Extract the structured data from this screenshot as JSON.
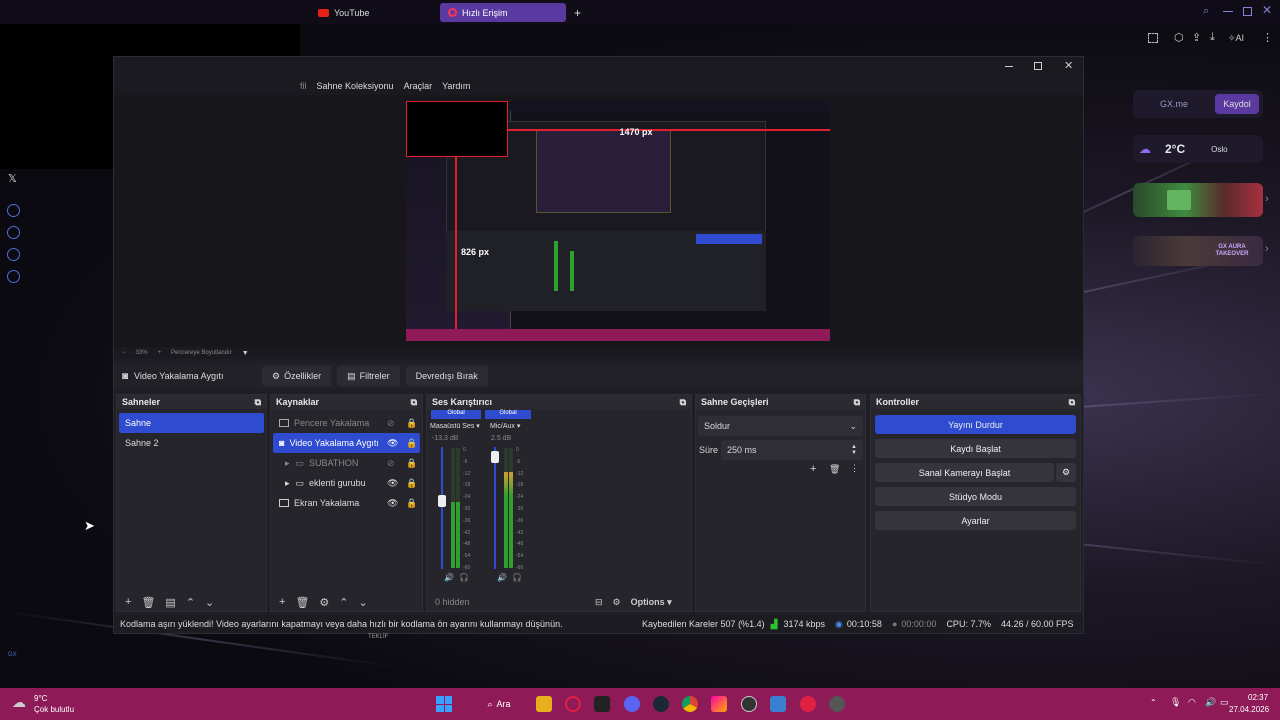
{
  "browser": {
    "tabs": [
      {
        "label": "YouTube"
      },
      {
        "label": "Hızlı Erişim"
      }
    ],
    "toolbar_ai": "AI"
  },
  "widgets": {
    "gx_me": "GX.me",
    "kaydol": "Kaydol",
    "temp": "2°C",
    "city": "Oslo",
    "aura": "GX AURA TAKEOVER"
  },
  "obs": {
    "menu": [
      "fil",
      "Sahne Koleksiyonu",
      "Araçlar",
      "Yardım"
    ],
    "preview": {
      "width_label": "1470 px",
      "height_label": "826 px"
    },
    "zoom": {
      "minus": "−",
      "value": "33%",
      "plus": "+",
      "fit": "Pencereye Boyutlandır"
    },
    "source_toolbar": {
      "name": "Video Yakalama Aygıtı",
      "properties": "Özellikler",
      "filters": "Filtreler",
      "deactivate": "Devredışı Bırak"
    },
    "scenes": {
      "title": "Sahneler",
      "items": [
        "Sahne",
        "Sahne 2"
      ]
    },
    "sources": {
      "title": "Kaynaklar",
      "items": [
        {
          "label": "Pencere Yakalama",
          "type": "window"
        },
        {
          "label": "Video Yakalama Aygıtı",
          "type": "camera"
        },
        {
          "label": "SUBATHON",
          "type": "group"
        },
        {
          "label": "eklenti gurubu",
          "type": "group"
        },
        {
          "label": "Ekran Yakalama",
          "type": "display"
        }
      ]
    },
    "mixer": {
      "title": "Ses Karıştırıcı",
      "channels": [
        {
          "badge": "Global",
          "name": "Masaüstü Ses",
          "db": "-13.3 dB",
          "level": 0.55
        },
        {
          "badge": "Global",
          "name": "Mic/Aux",
          "db": "2.5 dB",
          "level": 0.8
        }
      ],
      "scale": [
        "0",
        "-6",
        "-12",
        "-18",
        "-24",
        "-30",
        "-36",
        "-42",
        "-48",
        "-54",
        "-60"
      ],
      "hidden": "0 hidden",
      "options": "Options"
    },
    "transitions": {
      "title": "Sahne Geçişleri",
      "selected": "Soldur",
      "duration_label": "Süre",
      "duration": "250 ms"
    },
    "controls": {
      "title": "Kontroller",
      "buttons": [
        "Yayını Durdur",
        "Kaydı Başlat",
        "Sanal Kamerayı Başlat",
        "Stüdyo Modu",
        "Ayarlar"
      ]
    },
    "status": {
      "message": "Kodlama aşırı yüklendi! Video ayarlarını kapatmayı veya daha hızlı bir kodlama ön ayarını kullanmayı düşünün.",
      "dropped": "Kaybedilen Kareler 507 (%1.4)",
      "bitrate": "3174 kbps",
      "live_time": "00:10:58",
      "rec_time": "00:00:00",
      "cpu": "CPU: 7.7%",
      "fps": "44.26 / 60.00 FPS"
    }
  },
  "taskbar": {
    "weather_temp": "9°C",
    "weather_desc": "Çok bulutlu",
    "search": "Ara",
    "time": "02:37",
    "date": "27.04.2026"
  },
  "desktop": {
    "teklif": "TEKLİF"
  },
  "colors": {
    "accent": "#2f4bd0",
    "taskbar": "#8e1b57",
    "opera_purple": "#5a3aa0"
  }
}
